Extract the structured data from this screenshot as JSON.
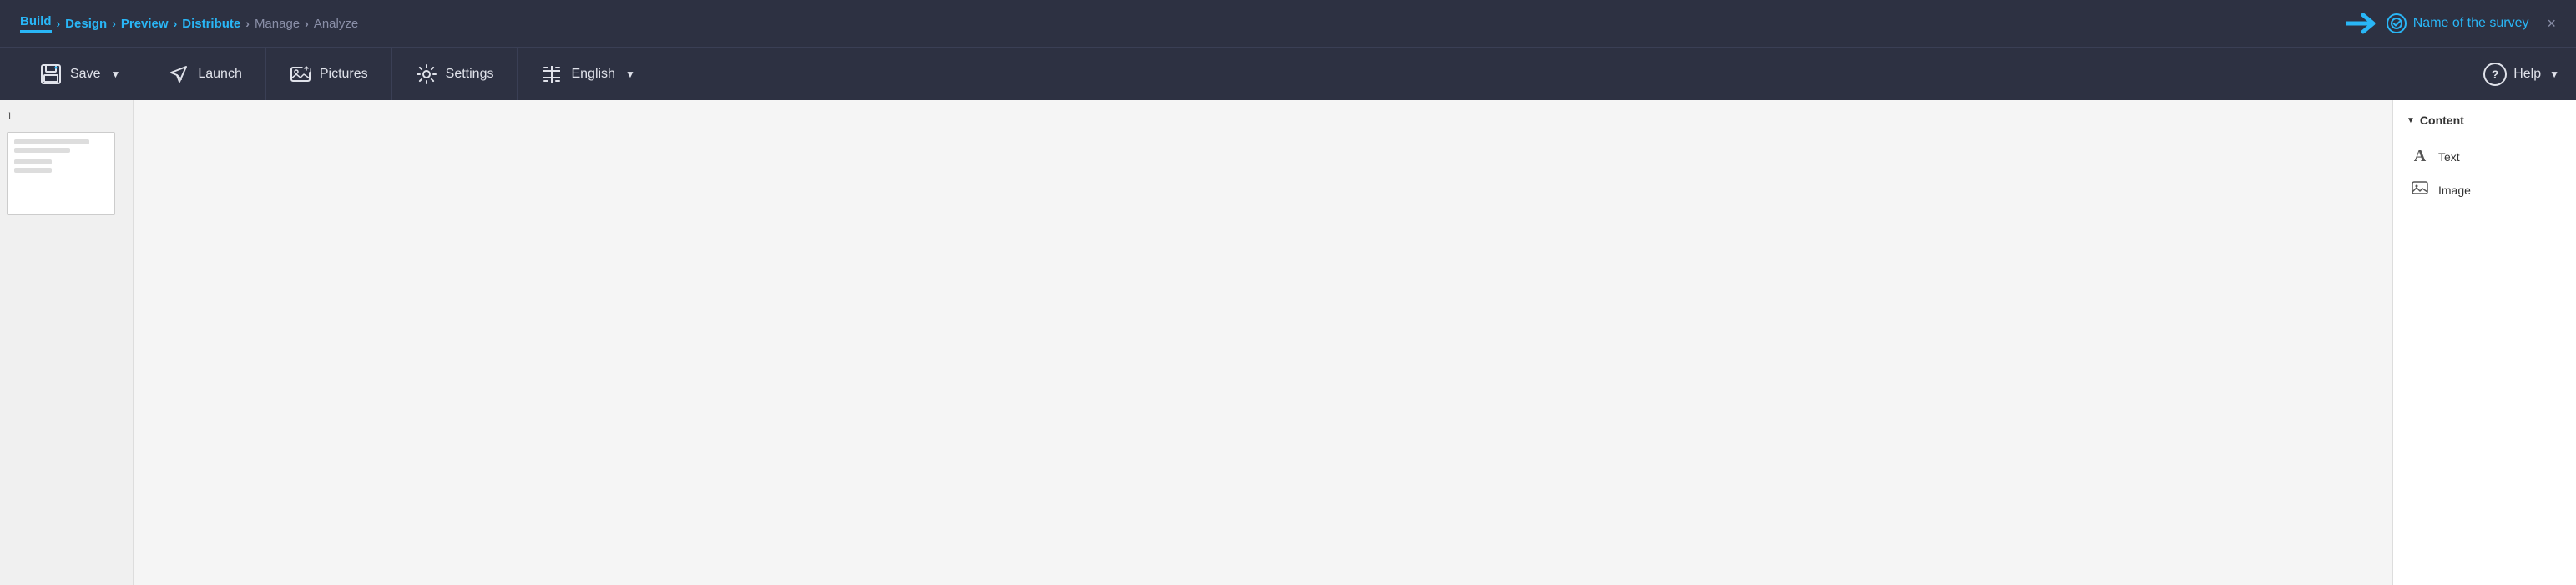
{
  "topnav": {
    "items": [
      {
        "label": "Build",
        "state": "active"
      },
      {
        "label": "Design",
        "state": "normal"
      },
      {
        "label": "Preview",
        "state": "normal"
      },
      {
        "label": "Distribute",
        "state": "normal"
      },
      {
        "label": "Manage",
        "state": "muted"
      },
      {
        "label": "Analyze",
        "state": "muted"
      }
    ],
    "survey_name": "Name of the survey",
    "close_label": "×"
  },
  "toolbar": {
    "save_label": "Save",
    "launch_label": "Launch",
    "pictures_label": "Pictures",
    "settings_label": "Settings",
    "english_label": "English",
    "help_label": "Help"
  },
  "sidebar": {
    "content_title": "Content",
    "items": [
      {
        "label": "Text",
        "icon": "A"
      },
      {
        "label": "Image",
        "icon": "🖼"
      }
    ]
  },
  "page": {
    "number": "1"
  }
}
